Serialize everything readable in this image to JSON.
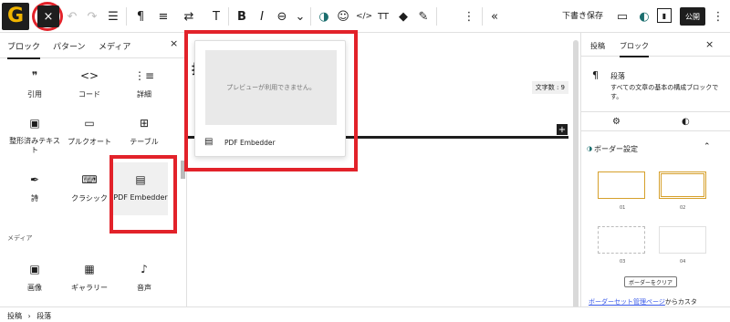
{
  "toolbar": {
    "logo": "G",
    "close": "×",
    "save_draft": "下書き保存",
    "publish": "公開",
    "icons": [
      "undo-icon",
      "redo-icon",
      "list-view-icon",
      "paragraph-icon",
      "align-icon",
      "transform-icon",
      "move-icon",
      "bold-icon",
      "italic-icon",
      "link-icon",
      "more-chevron-icon",
      "brand-icon",
      "emoji-icon",
      "code-icon",
      "text-size-icon",
      "highlight-icon",
      "marker-icon",
      "options-icon",
      "collapse-icon"
    ],
    "glyphs": {
      "undo": "↶",
      "redo": "↷",
      "list": "☰",
      "para": "¶",
      "align": "≡",
      "transform": "⇄",
      "move": "T",
      "bold": "B",
      "italic": "I",
      "link": "⊖",
      "chev": "⌄",
      "brand": "◑",
      "emoji": "☺",
      "code": "</>",
      "tt": "TT",
      "highlight": "◆",
      "marker": "✎",
      "opts": "⋮",
      "collapse": "«",
      "preview": "▭",
      "moon": "◐",
      "sidebar": "▮"
    }
  },
  "inserter": {
    "tabs": [
      "ブロック",
      "パターン",
      "メディア"
    ],
    "close": "×",
    "blocks": [
      {
        "label": "引用",
        "icon": "❞"
      },
      {
        "label": "コード",
        "icon": "<>"
      },
      {
        "label": "詳細",
        "icon": "⋮≡"
      },
      {
        "label": "整形済みテキスト",
        "icon": "▣"
      },
      {
        "label": "プルクオート",
        "icon": "▭"
      },
      {
        "label": "テーブル",
        "icon": "⊞"
      },
      {
        "label": "詩",
        "icon": "✒"
      },
      {
        "label": "クラシック",
        "icon": "⌨"
      },
      {
        "label": "PDF Embedder",
        "icon": "▤"
      }
    ],
    "media_section": "メディア",
    "media_blocks": [
      {
        "label": "画像",
        "icon": "▣"
      },
      {
        "label": "ギャラリー",
        "icon": "▦"
      },
      {
        "label": "音声",
        "icon": "♪"
      }
    ]
  },
  "editor": {
    "preview_text": "プレビューが利用できません。",
    "popup_title": "PDF Embedder",
    "word_count": "文字数 : 9",
    "plus": "+",
    "heading_fragment": "打"
  },
  "sidebar": {
    "tabs": [
      "投稿",
      "ブロック"
    ],
    "close": "×",
    "block_title": "段落",
    "block_desc": "すべての文章の基本の構成ブロックです。",
    "border_section": "ボーダー設定",
    "cards": [
      "01",
      "02",
      "03",
      "04"
    ],
    "clear_button": "ボーダーをクリア",
    "link_text": "ボーダーセット管理ページ",
    "link_suffix": "からカスタ"
  },
  "footer": {
    "crumb1": "投稿",
    "sep": "›",
    "crumb2": "段落"
  },
  "colors": {
    "accent": "#e2222a",
    "dark": "#1e1e1e",
    "logo": "#f0b400",
    "link": "#3858e9"
  }
}
